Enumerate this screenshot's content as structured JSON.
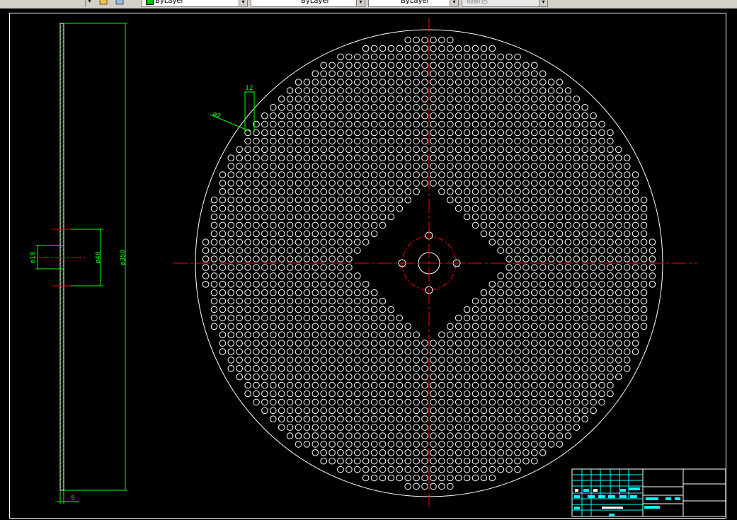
{
  "toolbar": {
    "layer_color": "ByLayer",
    "linetype": "ByLayer",
    "lineweight": "ByLayer",
    "plot_style": "随颜色"
  },
  "dims": {
    "hole_diameter": "ø2",
    "hole_pitch": "12",
    "thickness": "5",
    "bore_diameter": "ø18",
    "hub_diameter": "ø46",
    "outer_diameter": "ø350"
  },
  "colors": {
    "background": "#000000",
    "geometry": "#ffffff",
    "dimension": "#00ff00",
    "centerline": "#ff0000",
    "titleblock_text": "#00ffff"
  }
}
